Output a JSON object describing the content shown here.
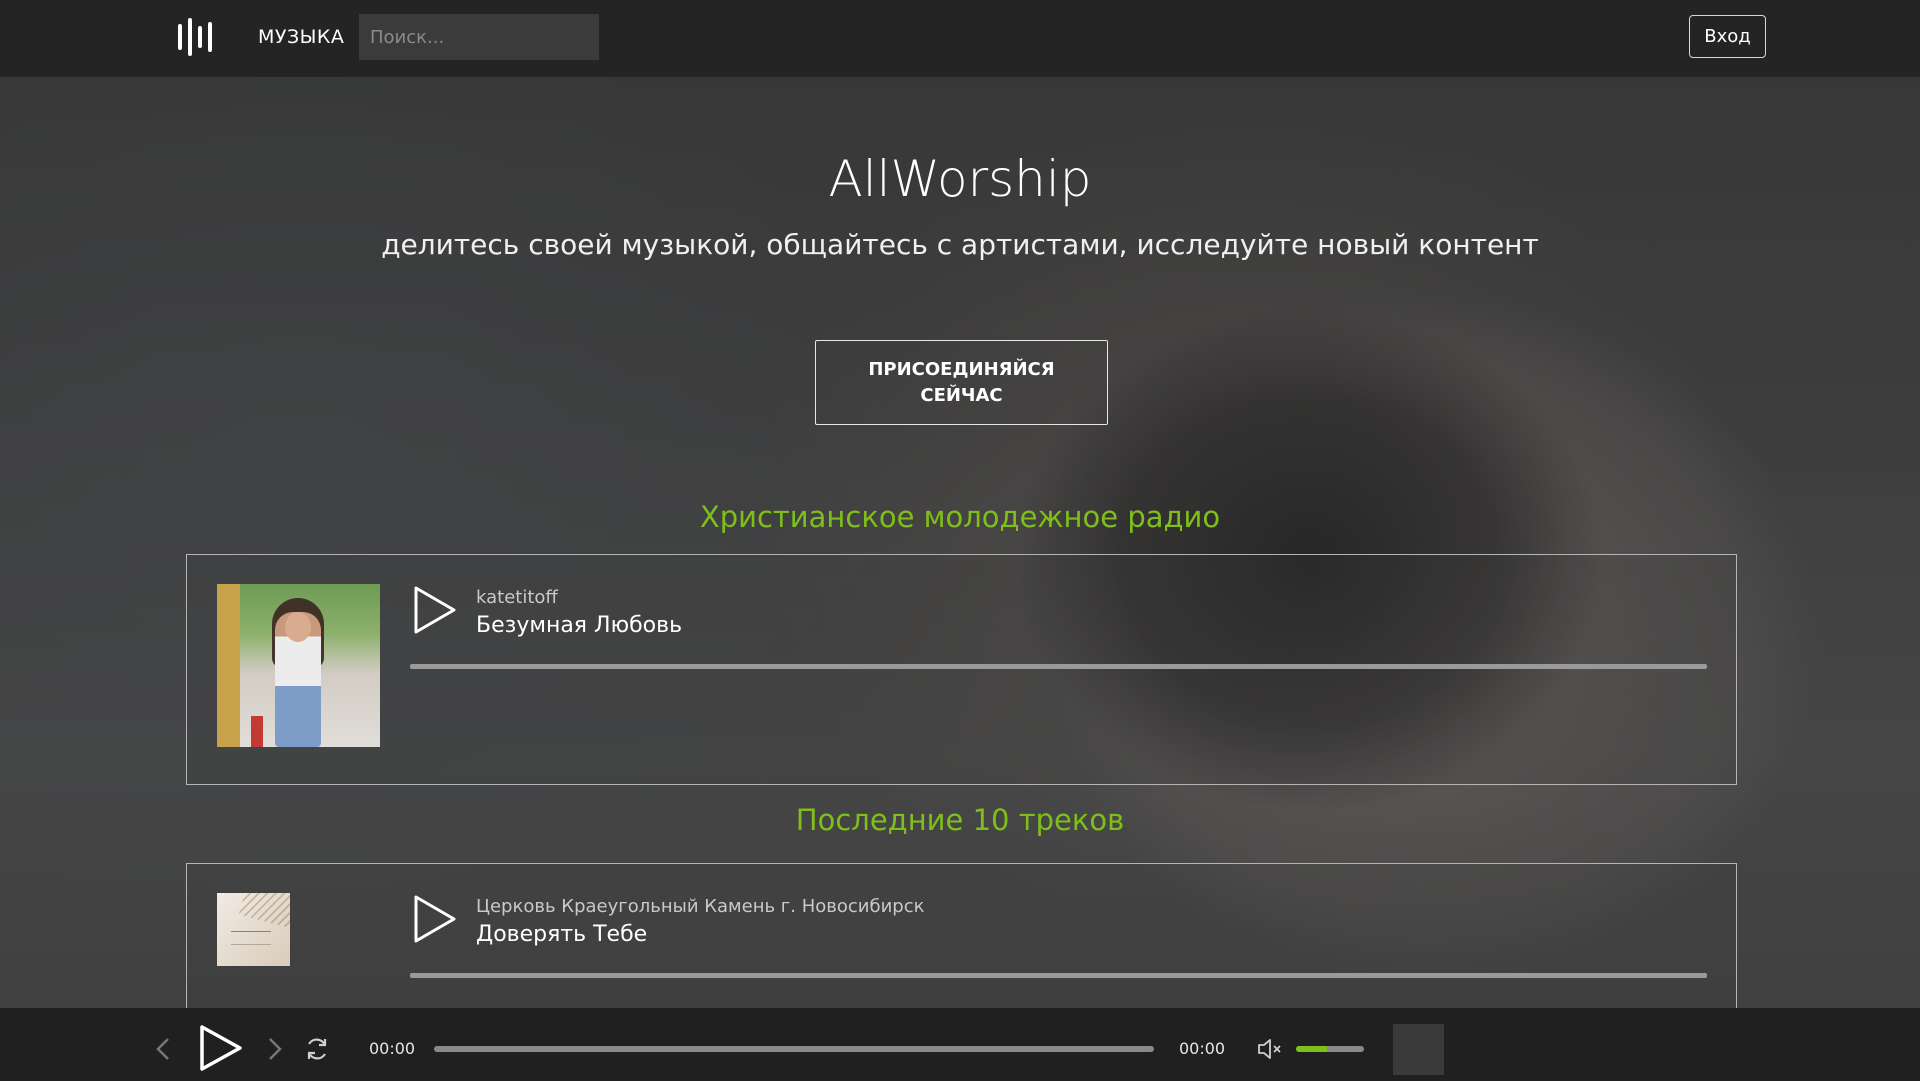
{
  "nav": {
    "music_label": "МУЗЫКА",
    "search_placeholder": "Поиск...",
    "login_label": "Вход"
  },
  "hero": {
    "title": "AllWorship",
    "subtitle": "делитесь своей музыкой, общайтесь с артистами, исследуйте новый контент",
    "join_label_line1": "ПРИСОЕДИНЯЙСЯ",
    "join_label_line2": "СЕЙЧАС"
  },
  "sections": [
    {
      "title": "Христианское молодежное радио",
      "tracks": [
        {
          "artist": "katetitoff",
          "title": "Безумная Любовь"
        }
      ]
    },
    {
      "title": "Последние 10 треков",
      "tracks": [
        {
          "artist": "Церковь Краеугольный Камень г. Новосибирск",
          "title": "Доверять Тебе"
        }
      ]
    }
  ],
  "player": {
    "current_time": "00:00",
    "total_time": "00:00",
    "volume_fraction": 0.45
  },
  "colors": {
    "accent": "#7fbf1a",
    "nav_bg": "#242424",
    "player_bg": "#202020"
  },
  "icons": [
    "logo-icon",
    "play-icon",
    "prev-icon",
    "next-icon",
    "repeat-icon",
    "volume-icon"
  ]
}
